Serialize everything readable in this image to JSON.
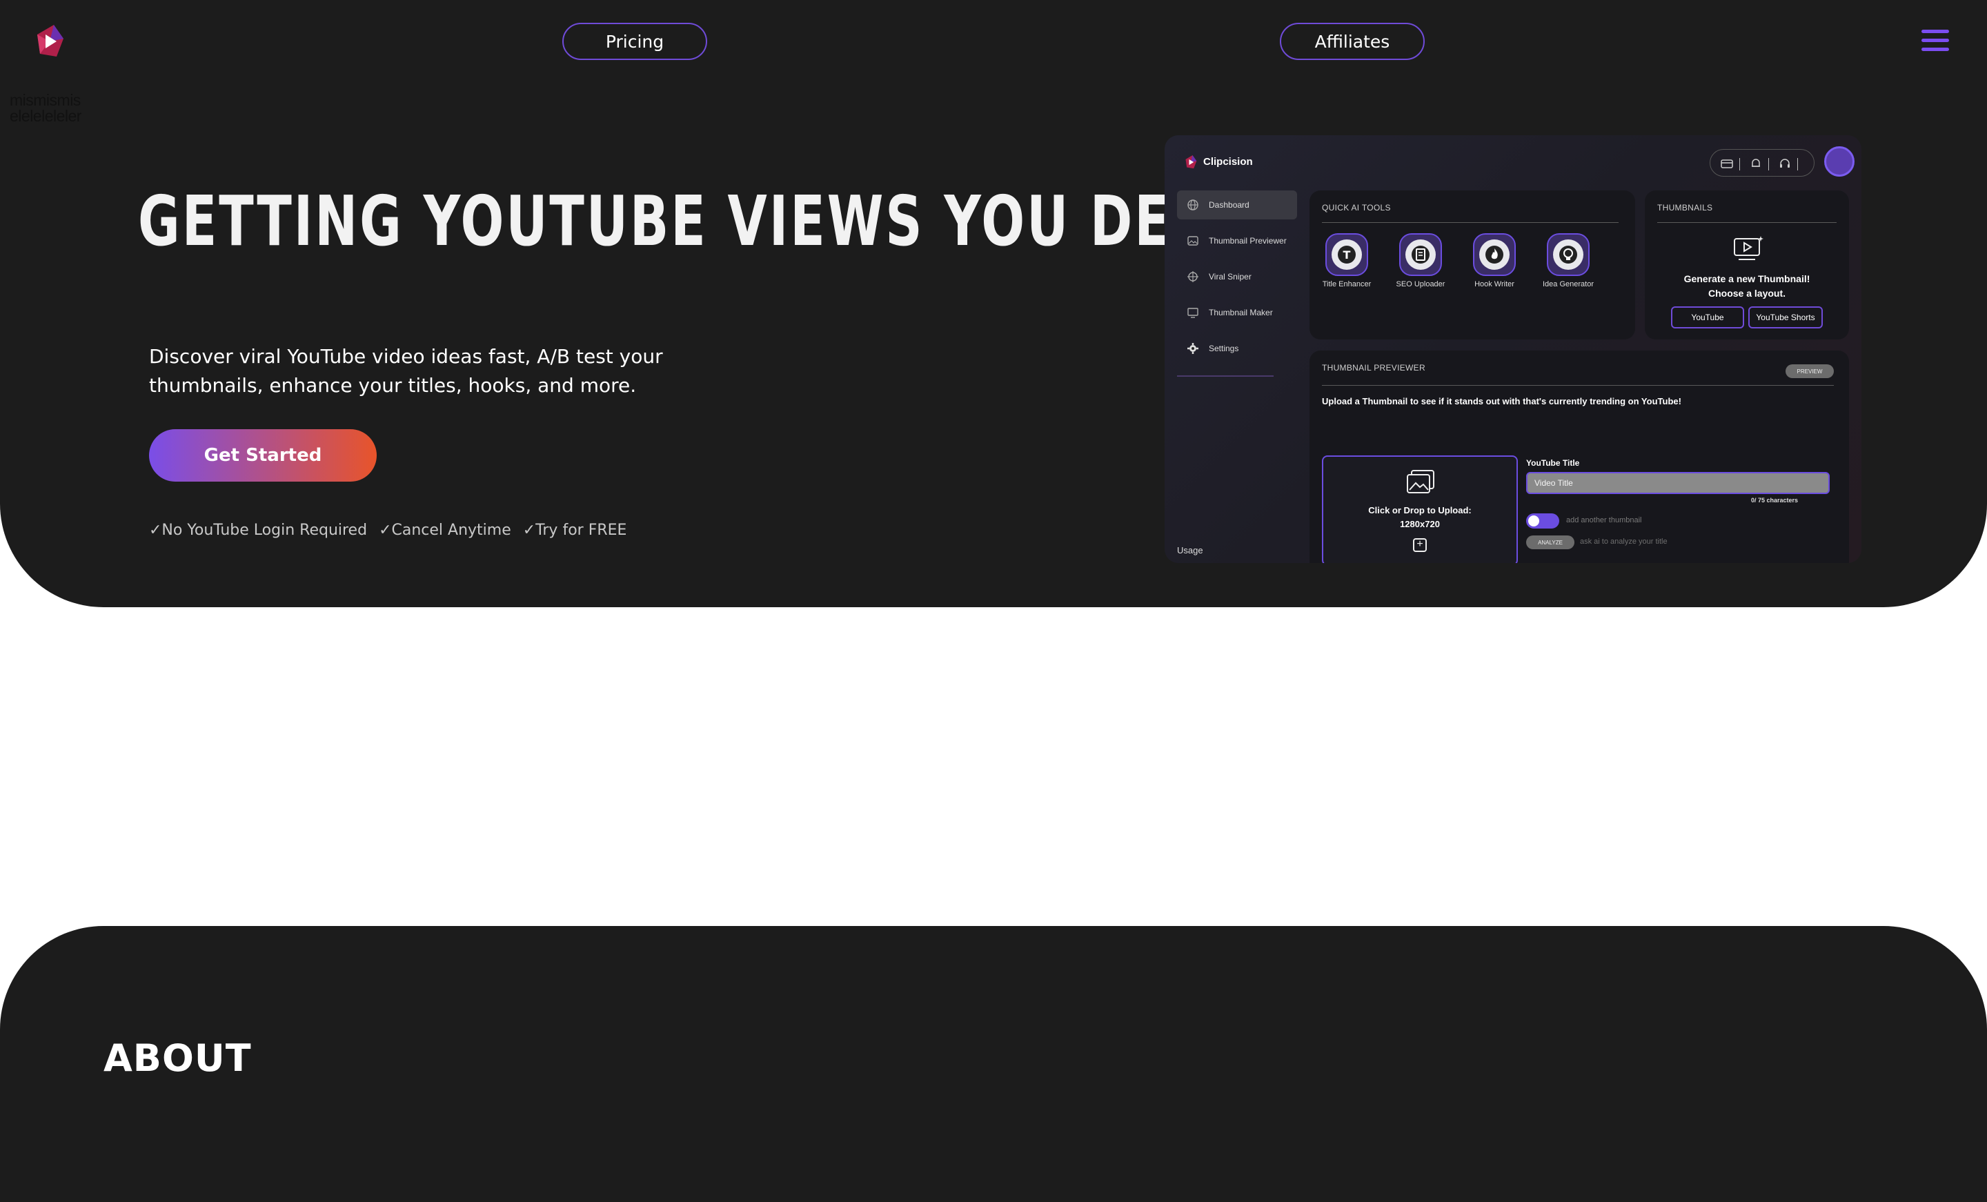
{
  "brand": {
    "logo_text": "mismismis eleleleleler",
    "accent": "#7b4df0",
    "cta_gradient": [
      "#7a4ee8",
      "#e8542a"
    ]
  },
  "nav": {
    "pricing": "Pricing",
    "affiliates": "Affiliates",
    "menu_icon": "hamburger-icon"
  },
  "hero": {
    "headline": "GETTING YOUTUBE VIEWS YOU DESERVE",
    "subtext": "Discover viral YouTube video ideas fast, A/B test your thumbnails, enhance your titles, hooks, and more.",
    "cta": "Get Started",
    "checks": [
      "✓No YouTube Login Required",
      "✓Cancel Anytime",
      "✓Try for FREE"
    ]
  },
  "app": {
    "brand": "Clipcision",
    "sidebar": [
      {
        "label": "Dashboard",
        "icon": "globe-icon"
      },
      {
        "label": "Thumbnail Previewer",
        "icon": "image-icon"
      },
      {
        "label": "Viral Sniper",
        "icon": "crosshair-icon"
      },
      {
        "label": "Thumbnail Maker",
        "icon": "monitor-icon"
      },
      {
        "label": "Settings",
        "icon": "gear-icon"
      }
    ],
    "usage": "Usage",
    "quick_tools": {
      "title": "QUICK AI TOOLS",
      "tools": [
        {
          "label": "Title Enhancer",
          "icon": "title-icon"
        },
        {
          "label": "SEO Uploader",
          "icon": "document-icon"
        },
        {
          "label": "Hook Writer",
          "icon": "flame-icon"
        },
        {
          "label": "Idea Generator",
          "icon": "bulb-icon"
        }
      ]
    },
    "thumbnails": {
      "title": "THUMBNAILS",
      "line1": "Generate a new Thumbnail!",
      "line2": "Choose a layout.",
      "btn_youtube": "YouTube",
      "btn_shorts": "YouTube Shorts"
    },
    "previewer": {
      "title": "THUMBNAIL PREVIEWER",
      "badge": "PREVIEW",
      "description": "Upload a Thumbnail to see if it stands out with that's currently trending on YouTube!",
      "dropzone_line1": "Click or Drop to Upload:",
      "dropzone_line2": "1280x720",
      "yt_title_label": "YouTube Title",
      "yt_title_placeholder": "Video Title",
      "char_count": "0/ 75 characters",
      "toggle_label": "add another thumbnail",
      "analyze_btn": "ANALYZE",
      "analyze_label": "ask ai to analyze your title"
    }
  },
  "about": {
    "title": "ABOUT"
  }
}
